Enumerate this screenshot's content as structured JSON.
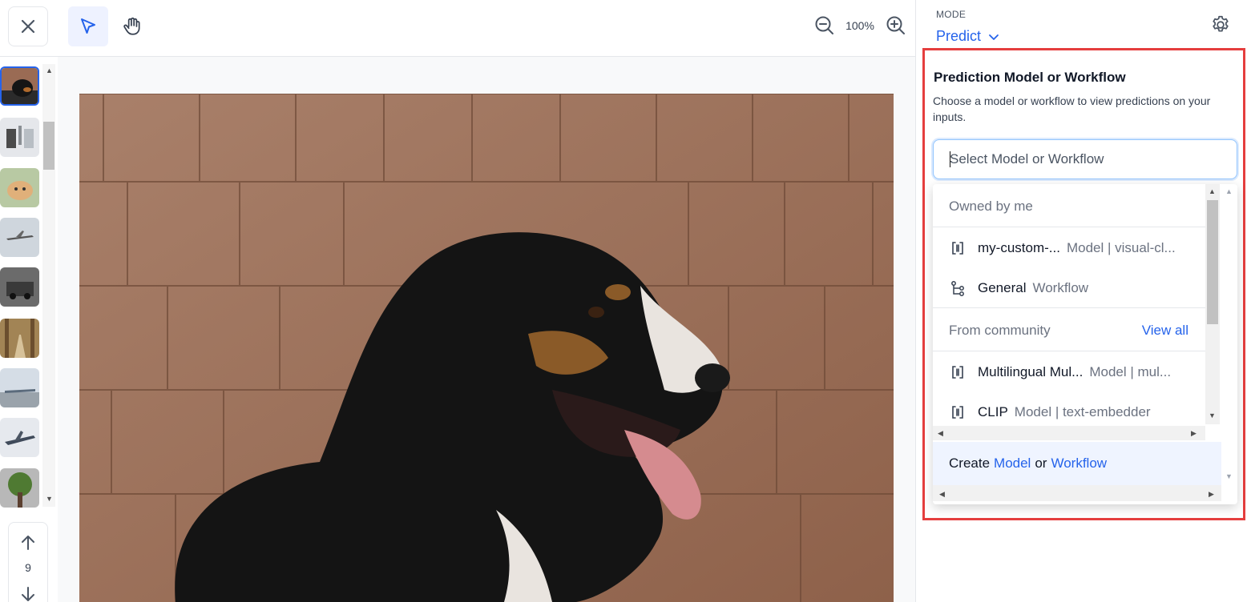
{
  "toolbar": {
    "close_icon": "close-icon",
    "select_tool_icon": "pointer-arrow-icon",
    "pan_tool_icon": "hand-icon",
    "zoom_level": "100%",
    "zoom_out_icon": "zoom-out-icon",
    "zoom_in_icon": "zoom-in-icon"
  },
  "thumbnails": {
    "items": [
      "dog",
      "bottle",
      "cat",
      "airplane",
      "car-street",
      "forest-road",
      "airplanes-runway",
      "jet-fighter",
      "tree"
    ],
    "current_index": "9"
  },
  "mode": {
    "label": "MODE",
    "value": "Predict"
  },
  "prediction_panel": {
    "title": "Prediction Model or Workflow",
    "description": "Choose a model or workflow to view predictions on your inputs.",
    "search_placeholder": "Select Model or Workflow",
    "sections": {
      "owned": {
        "label": "Owned by me",
        "items": [
          {
            "name": "my-custom-...",
            "type": "Model | visual-cl...",
            "icon": "model-icon"
          },
          {
            "name": "General",
            "type": "Workflow",
            "icon": "workflow-icon"
          }
        ]
      },
      "community": {
        "label": "From community",
        "view_all": "View all",
        "items": [
          {
            "name": "Multilingual Mul...",
            "type": "Model | mul...",
            "icon": "model-icon"
          },
          {
            "name": "CLIP",
            "type": "Model | text-embedder",
            "icon": "model-icon"
          }
        ]
      }
    },
    "create": {
      "prefix": "Create",
      "model_link": "Model",
      "or": "or",
      "workflow_link": "Workflow"
    }
  },
  "colors": {
    "accent": "#2563eb",
    "highlight_border": "#e53e3e"
  }
}
